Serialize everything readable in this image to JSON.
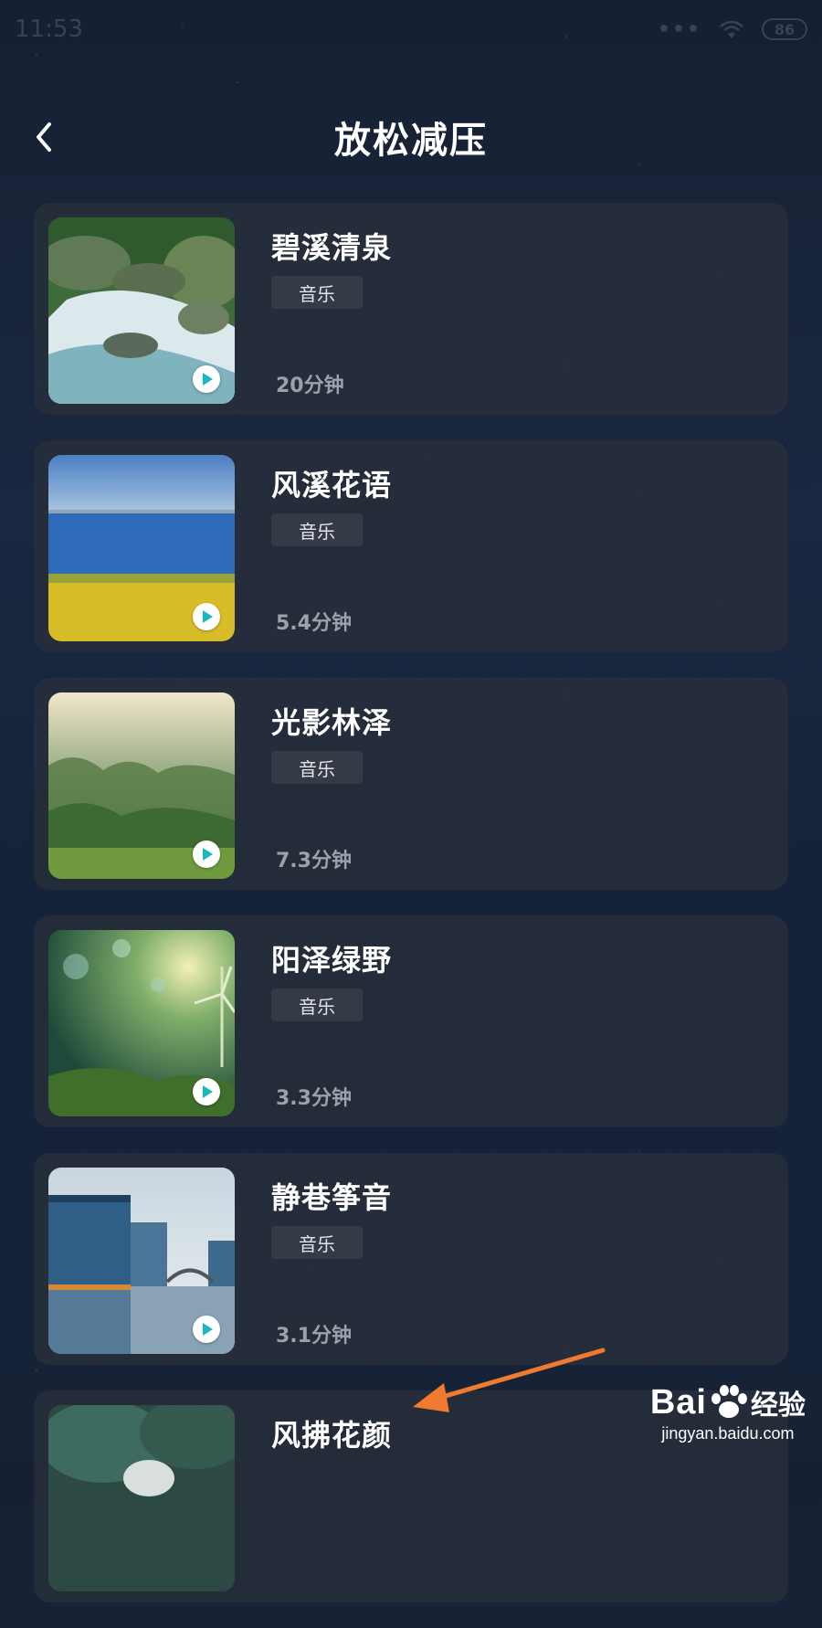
{
  "status_bar": {
    "time": "11:53",
    "dots": "•••",
    "battery": "86"
  },
  "header": {
    "title": "放松减压"
  },
  "items": [
    {
      "title": "碧溪清泉",
      "tag": "音乐",
      "duration": "20分钟",
      "thumb": "waterfall"
    },
    {
      "title": "风溪花语",
      "tag": "音乐",
      "duration": "5.4分钟",
      "thumb": "sea-field"
    },
    {
      "title": "光影林泽",
      "tag": "音乐",
      "duration": "7.3分钟",
      "thumb": "misty-forest"
    },
    {
      "title": "阳泽绿野",
      "tag": "音乐",
      "duration": "3.3分钟",
      "thumb": "green-meadow"
    },
    {
      "title": "静巷筝音",
      "tag": "音乐",
      "duration": "3.1分钟",
      "thumb": "water-town"
    },
    {
      "title": "风拂花颜",
      "tag": "",
      "duration": "",
      "thumb": "lotus"
    }
  ],
  "watermark": {
    "logo_left": "Bai",
    "logo_right": "经验",
    "domain": "jingyan.baidu.com"
  },
  "colors": {
    "accent_play": "#19b8c2",
    "arrow": "#f07a30"
  }
}
